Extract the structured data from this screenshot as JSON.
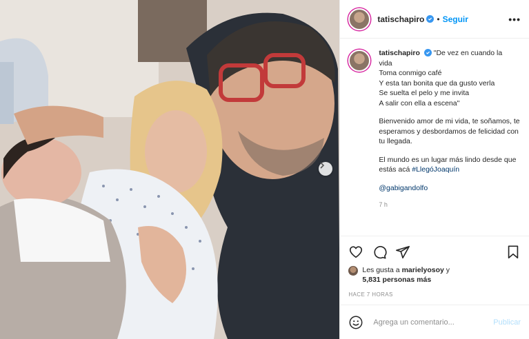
{
  "header": {
    "username": "tatischapiro",
    "separator": "•",
    "follow_label": "Seguir",
    "more_label": "•••"
  },
  "caption": {
    "username": "tatischapiro",
    "lines": [
      "\"De vez en cuando la",
      "vida",
      "Toma conmigo café",
      "Y esta tan bonita que da gusto verla",
      "Se suelta el pelo y me invita",
      "A salir con ella a escena\""
    ],
    "paragraph2": "Bienvenido amor de mi vida, te soñamos, te esperamos y desbordamos de felicidad con tu llegada.",
    "paragraph3_text": "El mundo es un lugar más lindo desde que estás acá",
    "hashtag": "#LlegóJoaquín",
    "mention": "@gabigandolfo",
    "time": "7 h"
  },
  "actions": {
    "like_icon": "heart-icon",
    "comment_icon": "comment-icon",
    "share_icon": "paper-plane-icon",
    "save_icon": "bookmark-icon"
  },
  "likes": {
    "line1_prefix": "Les gusta a",
    "line1_user": "marielyosoy",
    "line1_suffix": "y",
    "line2_count": "5,831 personas más"
  },
  "posted_ago": "HACE 7 HORAS",
  "comment_box": {
    "placeholder": "Agrega un comentario...",
    "publish_label": "Publicar"
  },
  "colors": {
    "link_blue": "#0095f6",
    "verified_blue": "#3897f0",
    "publish_disabled": "#b2dffc",
    "meta_gray": "#8e8e8e"
  }
}
